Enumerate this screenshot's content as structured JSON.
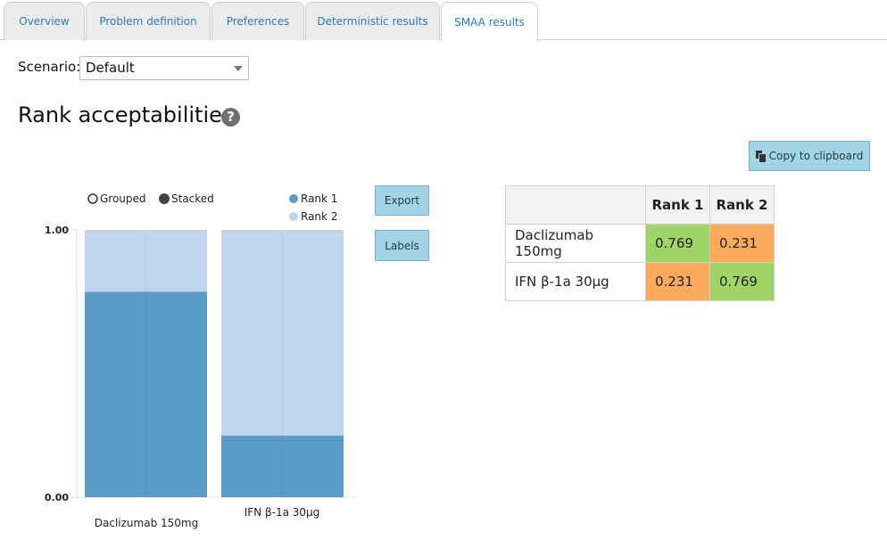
{
  "tabs": [
    {
      "label": "Overview"
    },
    {
      "label": "Problem definition"
    },
    {
      "label": "Preferences"
    },
    {
      "label": "Deterministic results"
    },
    {
      "label": "SMAA results"
    }
  ],
  "scenario": {
    "label": "Scenario:",
    "value": "Default"
  },
  "section": {
    "title": "Rank acceptabilities",
    "help_glyph": "?"
  },
  "buttons": {
    "copy": "Copy to clipboard",
    "export": "Export",
    "labels": "Labels"
  },
  "chart_controls": {
    "grouped": "Grouped",
    "stacked": "Stacked",
    "selected": "stacked"
  },
  "colors": {
    "rank1": "#5b9bc8",
    "rank2": "#c2d5ee",
    "high": "#a0d468",
    "low": "#fbaa5c",
    "tab_link": "#2a7ab8",
    "button": "#a2d4e6"
  },
  "chart_data": {
    "type": "bar",
    "stacked": true,
    "categories": [
      "Daclizumab 150mg",
      "IFN β-1a 30µg"
    ],
    "series": [
      {
        "name": "Rank 1",
        "values": [
          0.769,
          0.231
        ]
      },
      {
        "name": "Rank 2",
        "values": [
          0.231,
          0.769
        ]
      }
    ],
    "yticks": [
      "0.00",
      "1.00"
    ],
    "ylim": [
      0,
      1
    ],
    "legend_position": "top-right"
  },
  "table": {
    "headers": [
      "",
      "Rank 1",
      "Rank 2"
    ],
    "rows": [
      {
        "name": "Daclizumab 150mg",
        "values": [
          "0.769",
          "0.231"
        ],
        "colors": [
          "high",
          "low"
        ]
      },
      {
        "name": "IFN β-1a 30µg",
        "values": [
          "0.231",
          "0.769"
        ],
        "colors": [
          "low",
          "high"
        ]
      }
    ]
  }
}
